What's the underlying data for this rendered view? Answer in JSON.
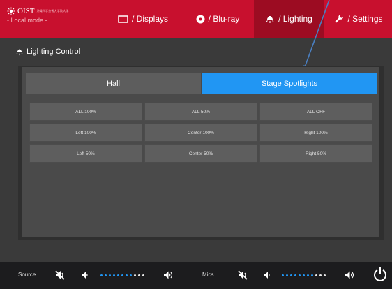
{
  "brand": {
    "name": "OIST",
    "subtitle": "沖縄科学技術大学院大学",
    "mode": "- Local mode -"
  },
  "nav": {
    "tabs": [
      {
        "label": "/ Displays",
        "icon": "display-icon",
        "active": false
      },
      {
        "label": "/ Blu-ray",
        "icon": "disc-icon",
        "active": false
      },
      {
        "label": "/ Lighting",
        "icon": "light-icon",
        "active": true
      },
      {
        "label": "/ Settings",
        "icon": "wrench-icon",
        "active": false
      }
    ]
  },
  "section": {
    "title": "Lighting Control",
    "icon": "light-icon"
  },
  "segments": [
    {
      "label": "Hall",
      "selected": false
    },
    {
      "label": "Stage Spotlights",
      "selected": true
    }
  ],
  "buttons": [
    [
      "ALL 100%",
      "ALL 50%",
      "ALL OFF"
    ],
    [
      "Left 100%",
      "Center 100%",
      "Right 100%"
    ],
    [
      "Left 50%",
      "Center 50%",
      "Right 50%"
    ]
  ],
  "audio": {
    "source": {
      "label": "Source",
      "level_filled": 8,
      "level_total": 11
    },
    "mics": {
      "label": "Mics",
      "level_filled": 8,
      "level_total": 11
    }
  },
  "colors": {
    "brand_red": "#c8102e",
    "active_tab": "#9c0c22",
    "accent": "#2196f3",
    "pointer": "#4a7fc1"
  }
}
